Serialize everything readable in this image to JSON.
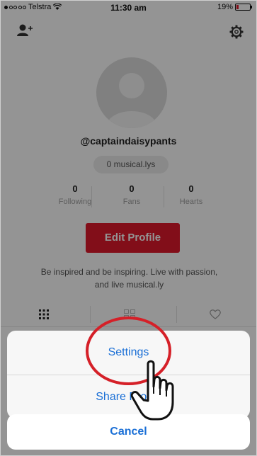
{
  "status_bar": {
    "carrier": "Telstra",
    "time": "11:30 am",
    "battery": "19%",
    "battery_level": 0.19
  },
  "icons": {
    "add_user": "add-user-icon",
    "settings": "gear-icon",
    "grid": "grid-icon",
    "heart": "heart-icon"
  },
  "profile": {
    "username": "@captaindaisypants",
    "musical_count": "0 musical.lys",
    "stats": [
      {
        "value": "0",
        "label": "Following"
      },
      {
        "value": "0",
        "label": "Fans"
      },
      {
        "value": "0",
        "label": "Hearts"
      }
    ],
    "edit_button": "Edit Profile",
    "bio_line1": "Be inspired and be inspiring. Live with passion,",
    "bio_line2": "and live musical.ly"
  },
  "action_sheet": {
    "items": [
      "Settings",
      "Share Profile"
    ],
    "cancel": "Cancel"
  },
  "colors": {
    "accent": "#e0192c",
    "ios_blue": "#1a6fd6",
    "ring": "#d52028"
  }
}
